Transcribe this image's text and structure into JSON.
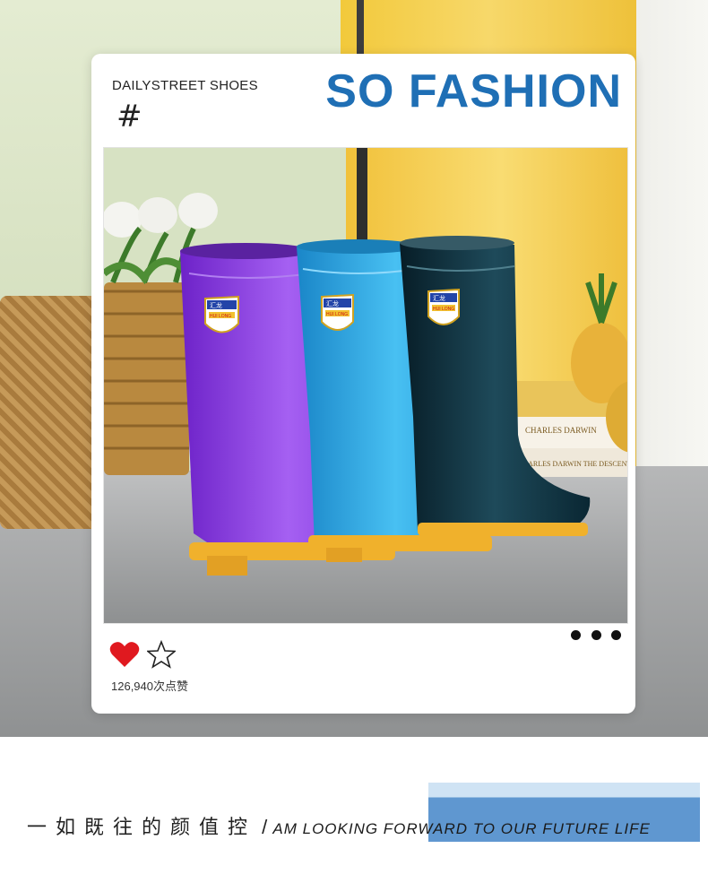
{
  "card": {
    "tagline": "DAILYSTREET SHOES",
    "hash_symbol": "#",
    "headline": "SO FASHION",
    "like_count": "126,940次点赞"
  },
  "boots": [
    {
      "brand_top": "汇龙",
      "brand_bottom": "HUI LONG",
      "color": "#8a3fe0"
    },
    {
      "brand_top": "汇龙",
      "brand_bottom": "HUI LONG",
      "color": "#2aa3e0"
    },
    {
      "brand_top": "汇龙",
      "brand_bottom": "HUI LONG",
      "color": "#0e2f3d"
    }
  ],
  "books": [
    "CHARLES DARWIN",
    "CHARLES DARWIN THE DESCENT OF MAN"
  ],
  "icons": [
    "heart-icon",
    "star-icon",
    "more-dots-icon"
  ],
  "footer": {
    "chinese": "一如既往的颜值控",
    "separator": "/",
    "english": "AM LOOKING FORWARD TO OUR FUTURE LIFE"
  },
  "colors": {
    "accent_blue": "#1f6fb5",
    "heart_red": "#e0191f",
    "footer_bar": "#5f97d0"
  }
}
